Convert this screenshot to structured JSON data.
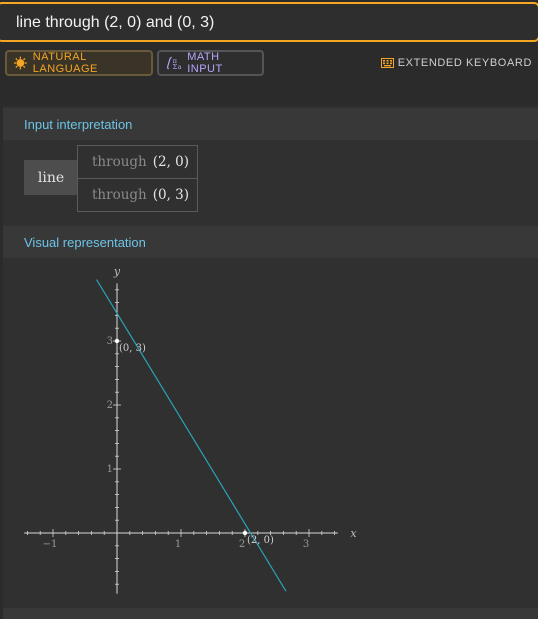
{
  "search": {
    "query": "line through (2, 0) and (0, 3)"
  },
  "modes": {
    "natural_language": "NATURAL LANGUAGE",
    "math_input": "MATH INPUT",
    "extended_keyboard": "EXTENDED KEYBOARD"
  },
  "pods": {
    "input_interpretation": {
      "title": "Input interpretation",
      "object": "line",
      "rows": [
        {
          "word": "through",
          "point": "(2, 0)"
        },
        {
          "word": "through",
          "point": "(0, 3)"
        }
      ]
    },
    "visual_representation": {
      "title": "Visual representation"
    }
  },
  "colors": {
    "accent": "#f5a623",
    "pod_title": "#6cc4e6",
    "line": "#2aa3b8",
    "math_icon": "#b9a6ff"
  },
  "icons": [
    "sun-icon",
    "math-sigma-icon",
    "keyboard-icon"
  ],
  "chart_data": {
    "type": "line",
    "xlabel": "x",
    "ylabel": "y",
    "x_ticks": [
      -1,
      1,
      2,
      3
    ],
    "y_ticks": [
      1,
      2,
      3
    ],
    "series": [
      {
        "x": [
          -0.32,
          2.64
        ],
        "y": [
          3.96,
          -0.91
        ]
      }
    ],
    "points": [
      {
        "x": 0,
        "y": 3,
        "label": "(0, 3)"
      },
      {
        "x": 2,
        "y": 0,
        "label": "(2, 0)"
      }
    ],
    "grid": false
  }
}
